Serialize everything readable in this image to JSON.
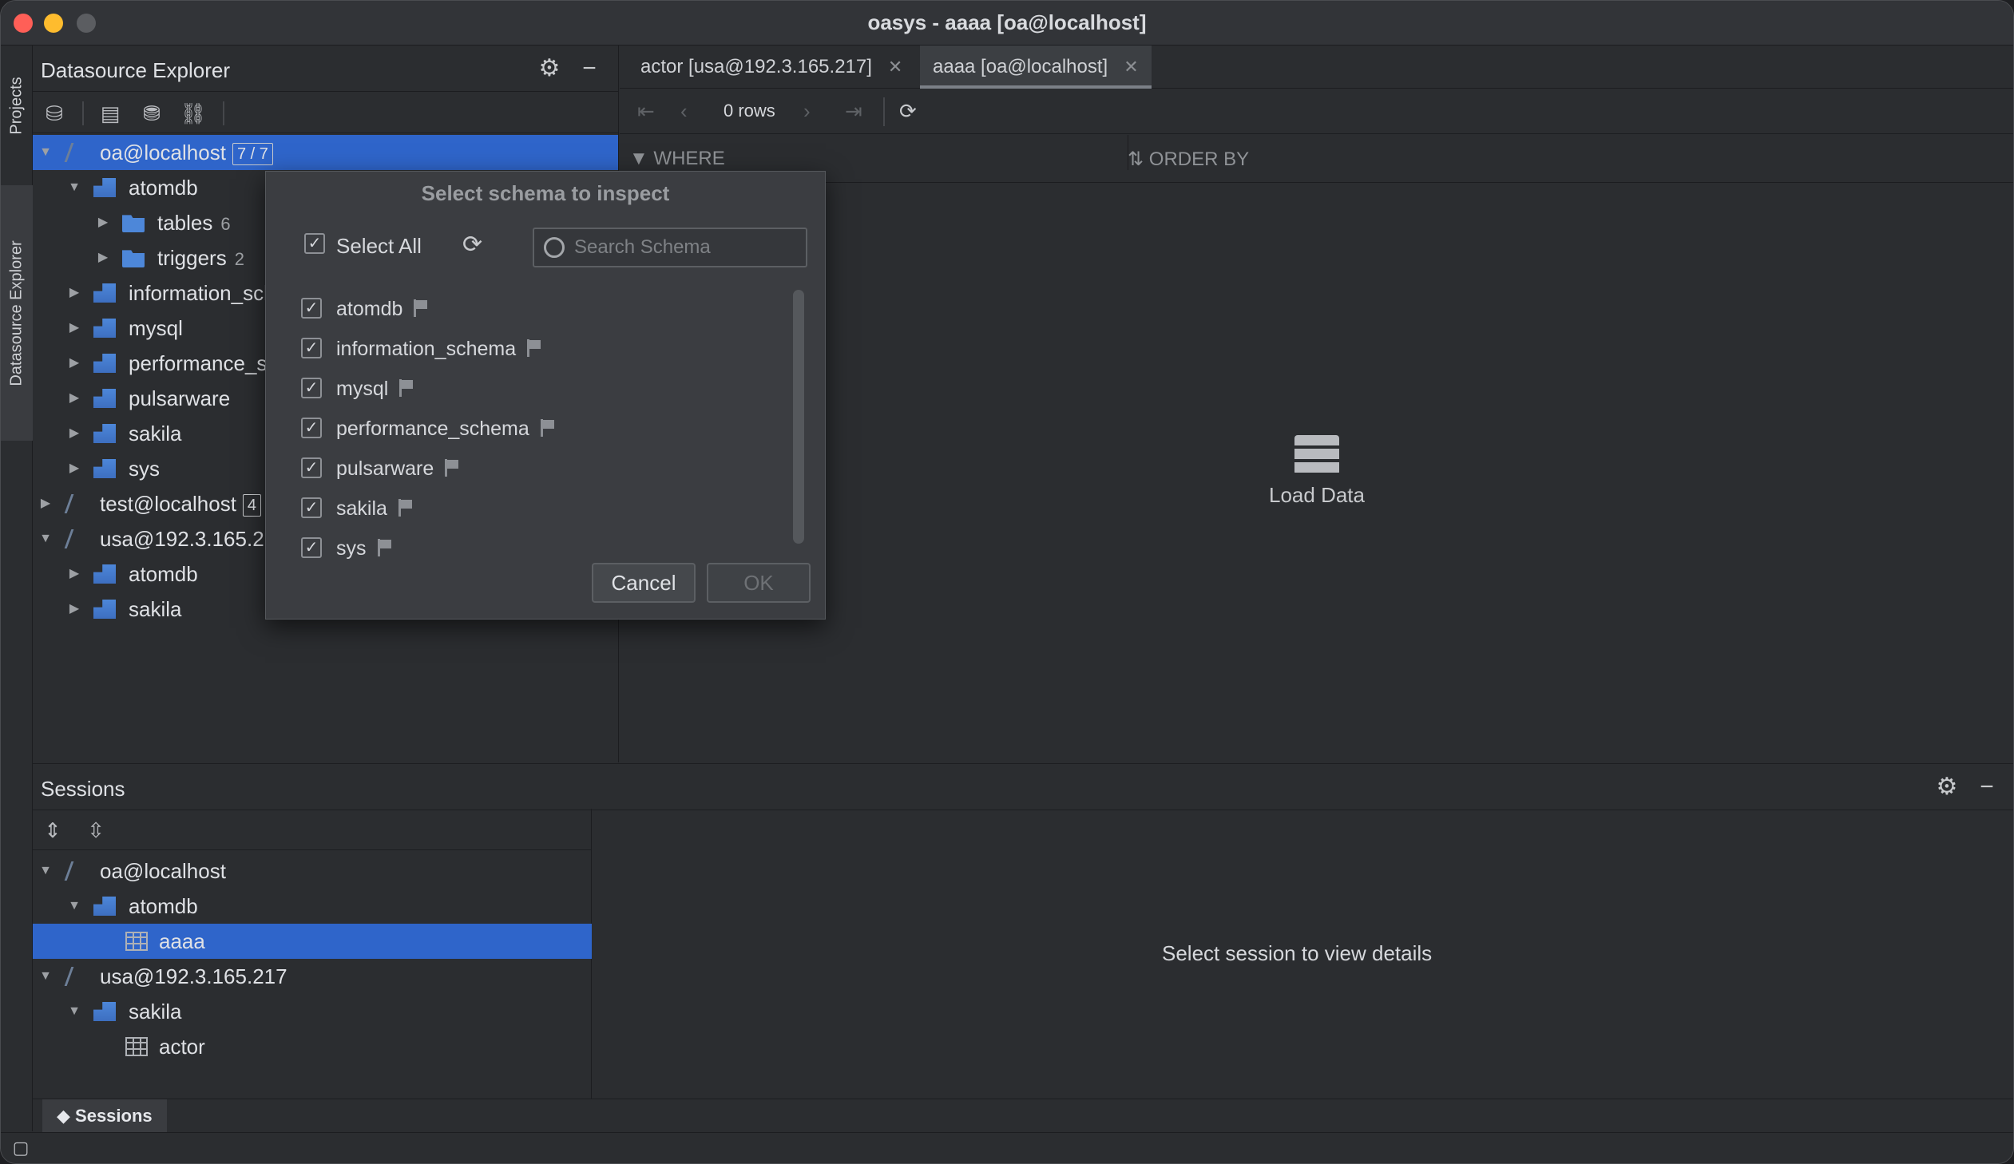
{
  "window": {
    "title": "oasys - aaaa [oa@localhost]"
  },
  "left_strip": {
    "projects": "Projects",
    "datasource_explorer": "Datasource Explorer"
  },
  "datasource_explorer": {
    "title": "Datasource Explorer",
    "tree": [
      {
        "label": "oa@localhost",
        "badge": "7 / 7"
      },
      {
        "label": "atomdb"
      },
      {
        "label": "tables",
        "count": "6"
      },
      {
        "label": "triggers",
        "count": "2"
      },
      {
        "label": "information_schema"
      },
      {
        "label": "mysql"
      },
      {
        "label": "performance_schema"
      },
      {
        "label": "pulsarware"
      },
      {
        "label": "sakila"
      },
      {
        "label": "sys"
      },
      {
        "label": "test@localhost",
        "badge": "4"
      },
      {
        "label": "usa@192.3.165.217"
      },
      {
        "label": "atomdb"
      },
      {
        "label": "sakila"
      }
    ]
  },
  "tabs": [
    {
      "label": "actor [usa@192.3.165.217]"
    },
    {
      "label": "aaaa [oa@localhost]"
    }
  ],
  "resultset": {
    "rows_label": "0 rows",
    "where_label": "WHERE",
    "order_by_label": "ORDER BY",
    "load_data_label": "Load Data"
  },
  "dialog": {
    "title": "Select schema to inspect",
    "select_all_label": "Select All",
    "search_placeholder": "Search Schema",
    "schemas": [
      "atomdb",
      "information_schema",
      "mysql",
      "performance_schema",
      "pulsarware",
      "sakila",
      "sys"
    ],
    "cancel_label": "Cancel",
    "ok_label": "OK"
  },
  "sessions": {
    "title": "Sessions",
    "tree": [
      {
        "label": "oa@localhost"
      },
      {
        "label": "atomdb"
      },
      {
        "label": "aaaa"
      },
      {
        "label": "usa@192.3.165.217"
      },
      {
        "label": "sakila"
      },
      {
        "label": "actor"
      }
    ],
    "details_placeholder": "Select session to view details",
    "bottom_tab_label": "Sessions"
  },
  "colors": {
    "selection": "#2f65ca",
    "schema_icon": "#4d87d9"
  }
}
